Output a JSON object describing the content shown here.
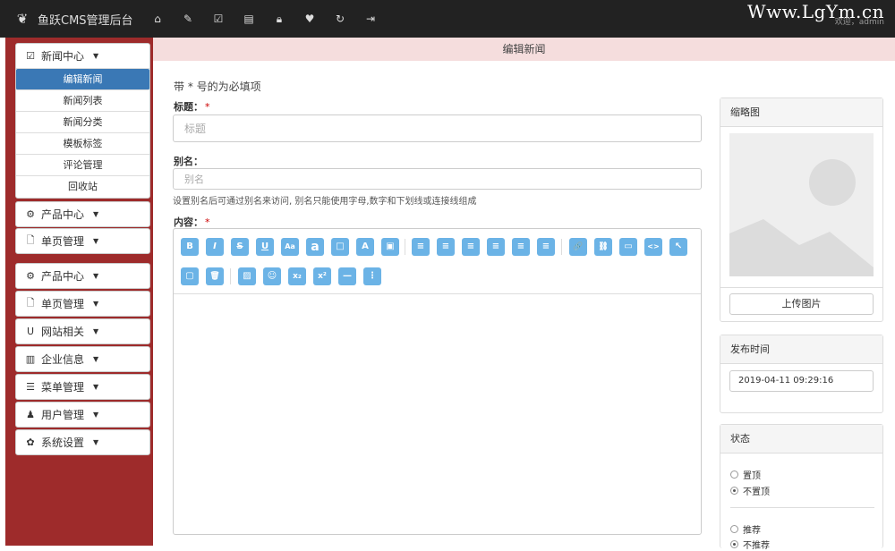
{
  "topbar": {
    "app_title": "鱼跃CMS管理后台",
    "site": "Www.LgYm.cn",
    "user": "欢迎，admin",
    "nav_icons": [
      "home-icon",
      "pencil-icon",
      "edit-icon",
      "list-icon",
      "lock-icon",
      "heart-icon",
      "refresh-icon",
      "logout-icon"
    ]
  },
  "sidebar": {
    "news": {
      "label": "新闻中心",
      "items": [
        "编辑新闻",
        "新闻列表",
        "新闻分类",
        "模板标签",
        "评论管理",
        "回收站"
      ],
      "active": 0
    },
    "groups": [
      {
        "label": "产品中心",
        "icon": "gears-icon"
      },
      {
        "label": "单页管理",
        "icon": "file-icon"
      },
      {
        "label": "产品中心",
        "icon": "gears-icon"
      },
      {
        "label": "单页管理",
        "icon": "file-icon"
      },
      {
        "label": "网站相关",
        "icon": "magnet-icon"
      },
      {
        "label": "企业信息",
        "icon": "bar-chart-icon"
      },
      {
        "label": "菜单管理",
        "icon": "list-icon"
      },
      {
        "label": "用户管理",
        "icon": "user-icon"
      },
      {
        "label": "系统设置",
        "icon": "cog-icon"
      }
    ]
  },
  "main": {
    "page_title": "编辑新闻",
    "required_note": "带 * 号的为必填项",
    "title_label": "标题：",
    "title_placeholder": "标题",
    "alias_label": "别名：",
    "alias_placeholder": "别名",
    "alias_help": "设置别名后可通过别名来访问, 别名只能使用字母,数字和下划线或连接线组成",
    "content_label": "内容：",
    "required_mark": "*",
    "editor_tools_row1": [
      "B",
      "I",
      "S",
      "U",
      "Aa",
      "a",
      "□",
      "A",
      "▣",
      "≡",
      "≡",
      "≡",
      "≡",
      "≡",
      "≡",
      "🔗",
      "⛓",
      "▭",
      "<>",
      "↖"
    ],
    "editor_tools_row2": [
      "▢",
      "🗑",
      "▨",
      "☺",
      "x₂",
      "x²",
      "—",
      "⋮"
    ]
  },
  "right": {
    "thumb_title": "缩略图",
    "upload_label": "上传图片",
    "publish_title": "发布时间",
    "publish_value": "2019-04-11 09:29:16",
    "status_title": "状态",
    "radios": [
      {
        "label": "置顶",
        "checked": false
      },
      {
        "label": "不置顶",
        "checked": true
      },
      {
        "label": "推荐",
        "checked": false
      },
      {
        "label": "不推荐",
        "checked": true
      }
    ]
  },
  "colors": {
    "accent": "#3a78b5",
    "sidebar": "#9e2b2b",
    "toolbar_button": "#6bb3e6",
    "header": "#f5dddd"
  }
}
